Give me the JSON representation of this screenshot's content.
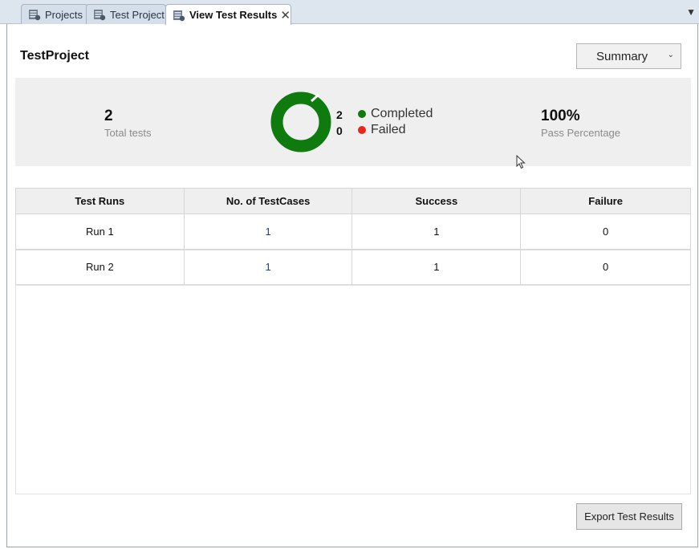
{
  "tabs": [
    {
      "label": "Projects",
      "active": false
    },
    {
      "label": "Test Project",
      "active": false
    },
    {
      "label": "View Test Results",
      "active": true
    }
  ],
  "header": {
    "project_name": "TestProject",
    "view_select": {
      "value": "Summary"
    }
  },
  "summary": {
    "total_tests": {
      "value": "2",
      "label": "Total tests"
    },
    "legend": [
      {
        "count": "2",
        "label": "Completed",
        "color": "#0f7b0f"
      },
      {
        "count": "0",
        "label": "Failed",
        "color": "#e8261c"
      }
    ],
    "pass_percentage": {
      "value": "100%",
      "label": "Pass Percentage"
    },
    "donut": {
      "completed": 2,
      "failed": 0
    }
  },
  "table": {
    "columns": [
      "Test Runs",
      "No. of TestCases",
      "Success",
      "Failure"
    ],
    "rows": [
      [
        "Run 1",
        "1",
        "1",
        "0"
      ],
      [
        "Run 2",
        "1",
        "1",
        "0"
      ]
    ]
  },
  "footer": {
    "export_label": "Export Test Results"
  },
  "colors": {
    "completed": "#0f7b0f",
    "failed": "#e8261c",
    "band_bg": "#efefef"
  }
}
